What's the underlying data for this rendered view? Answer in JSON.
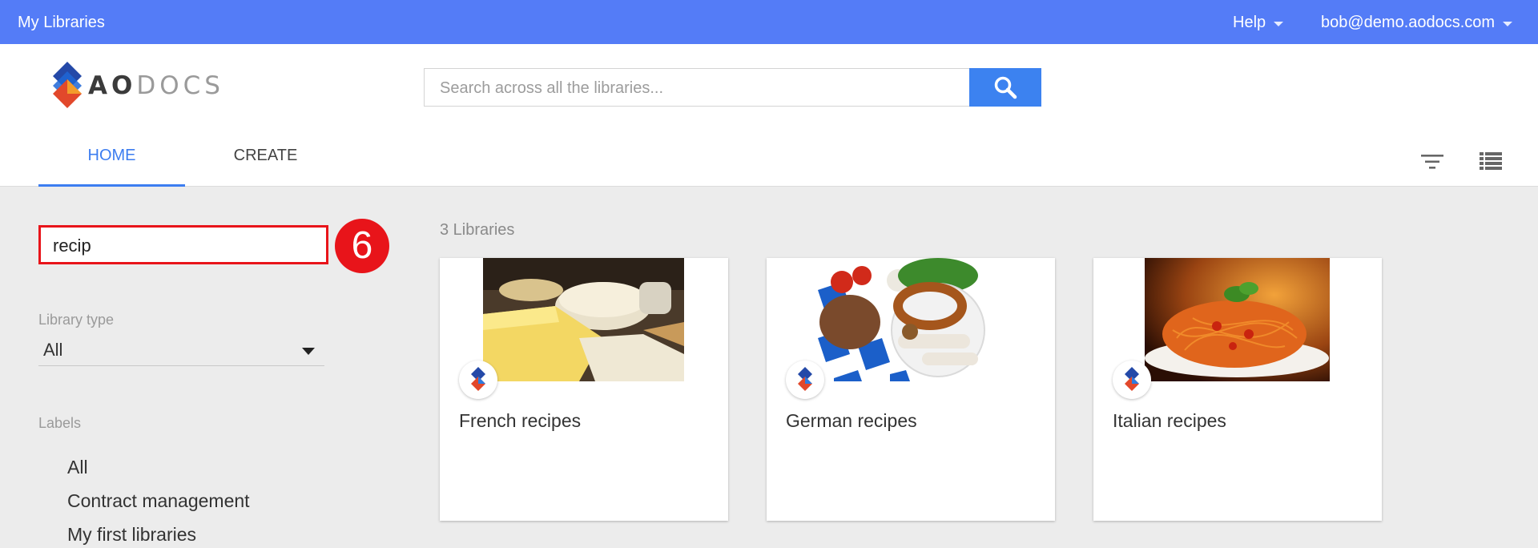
{
  "topbar": {
    "title": "My Libraries",
    "help_label": "Help",
    "user_email": "bob@demo.aodocs.com"
  },
  "header": {
    "logo_text_bold": "AO",
    "logo_text_light": "DOCS",
    "search_placeholder": "Search across all the libraries...",
    "tabs": [
      {
        "label": "HOME",
        "active": true
      },
      {
        "label": "CREATE",
        "active": false
      }
    ]
  },
  "sidebar": {
    "filter_value": "recip",
    "step_badge": "6",
    "library_type_label": "Library type",
    "library_type_value": "All",
    "labels_heading": "Labels",
    "labels": [
      "All",
      "Contract management",
      "My first libraries"
    ]
  },
  "main": {
    "library_count": "3 Libraries",
    "libraries": [
      {
        "name": "French recipes",
        "image": "cheese-platter"
      },
      {
        "name": "German recipes",
        "image": "pretzel-sausages"
      },
      {
        "name": "Italian recipes",
        "image": "spaghetti"
      }
    ]
  },
  "colors": {
    "topbar": "#547cf7",
    "accent": "#3c7df0",
    "highlight": "#e8141a"
  }
}
